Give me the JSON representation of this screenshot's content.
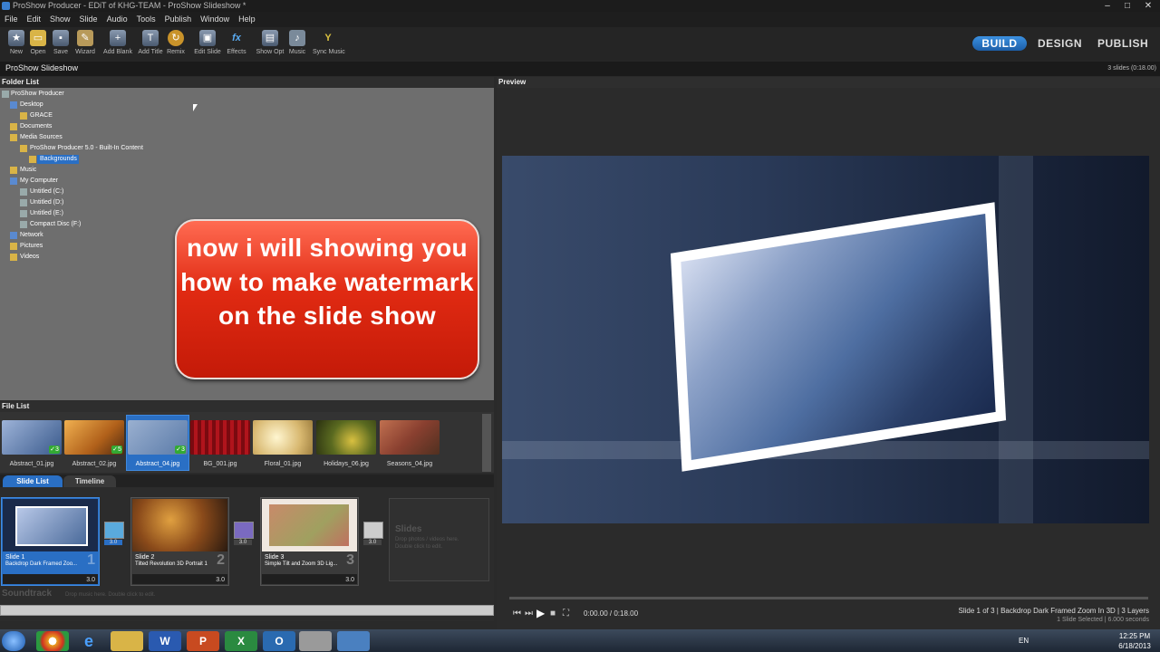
{
  "window": {
    "title": "ProShow Producer - EDiT of KHG-TEAM - ProShow Slideshow *"
  },
  "menu": [
    "File",
    "Edit",
    "Show",
    "Slide",
    "Audio",
    "Tools",
    "Publish",
    "Window",
    "Help"
  ],
  "toolbar": [
    {
      "label": "New",
      "icon": "new-icon"
    },
    {
      "label": "Open",
      "icon": "open-icon"
    },
    {
      "label": "Save",
      "icon": "save-icon"
    },
    {
      "label": "Wizard",
      "icon": "wizard-icon"
    },
    {
      "label": "Add Blank",
      "icon": "add-blank-icon"
    },
    {
      "label": "Add Title",
      "icon": "add-title-icon"
    },
    {
      "label": "Remix",
      "icon": "remix-icon"
    },
    {
      "label": "Edit Slide",
      "icon": "edit-slide-icon"
    },
    {
      "label": "Effects",
      "icon": "effects-icon"
    },
    {
      "label": "Show Opt",
      "icon": "show-opt-icon"
    },
    {
      "label": "Music",
      "icon": "music-icon"
    },
    {
      "label": "Sync Music",
      "icon": "sync-music-icon"
    }
  ],
  "modes": {
    "build": "BUILD",
    "design": "DESIGN",
    "publish": "PUBLISH"
  },
  "show": {
    "name": "ProShow Slideshow",
    "summary": "3 slides (0:18.00)"
  },
  "folder_list": {
    "header": "Folder List",
    "items": [
      "ProShow Producer",
      "Desktop",
      "GRACE",
      "Documents",
      "Media Sources",
      "ProShow Producer 5.0 - Built-In Content",
      "Backgrounds",
      "Music",
      "My Computer",
      "Untitled (C:)",
      "Untitled (D:)",
      "Untitled (E:)",
      "Compact Disc (F:)",
      "Network",
      "Pictures",
      "Videos"
    ]
  },
  "callout": {
    "text": "now i will showing you how to make watermark on the slide show"
  },
  "preview": {
    "header": "Preview"
  },
  "file_list": {
    "header": "File List",
    "files": [
      {
        "name": "Abstract_01.jpg",
        "uses": "3"
      },
      {
        "name": "Abstract_02.jpg",
        "uses": "5"
      },
      {
        "name": "Abstract_04.jpg",
        "uses": "3"
      },
      {
        "name": "BG_001.jpg",
        "uses": ""
      },
      {
        "name": "Floral_01.jpg",
        "uses": ""
      },
      {
        "name": "Holidays_06.jpg",
        "uses": ""
      },
      {
        "name": "Seasons_04.jpg",
        "uses": ""
      }
    ]
  },
  "tabs": {
    "slide_list": "Slide List",
    "timeline": "Timeline"
  },
  "slides": [
    {
      "title": "Slide 1",
      "subtitle": "Backdrop Dark Framed Zoo...",
      "number": "1",
      "time": "3.0",
      "transition": "3.0"
    },
    {
      "title": "Slide 2",
      "subtitle": "Tilted Revolution 3D Portrait 1",
      "number": "2",
      "time": "3.0",
      "transition": "3.0"
    },
    {
      "title": "Slide 3",
      "subtitle": "Simple Tilt and Zoom 3D Lig...",
      "number": "3",
      "time": "3.0",
      "transition": "3.0"
    }
  ],
  "slides_placeholder": {
    "title": "Slides",
    "hint1": "Drop photos / videos here.",
    "hint2": "Double click to edit."
  },
  "soundtrack": {
    "label": "Soundtrack",
    "hint": "Drop music here.  Double click to edit."
  },
  "transport": {
    "time": "0:00.00 / 0:18.00"
  },
  "status": {
    "line1": "Slide 1 of 3  |  Backdrop Dark Framed Zoom In 3D  |  3 Layers",
    "line2": "1 Slide Selected  |  6.000 seconds"
  },
  "taskbar": {
    "lang": "EN",
    "time": "12:25 PM",
    "date": "6/18/2013"
  }
}
